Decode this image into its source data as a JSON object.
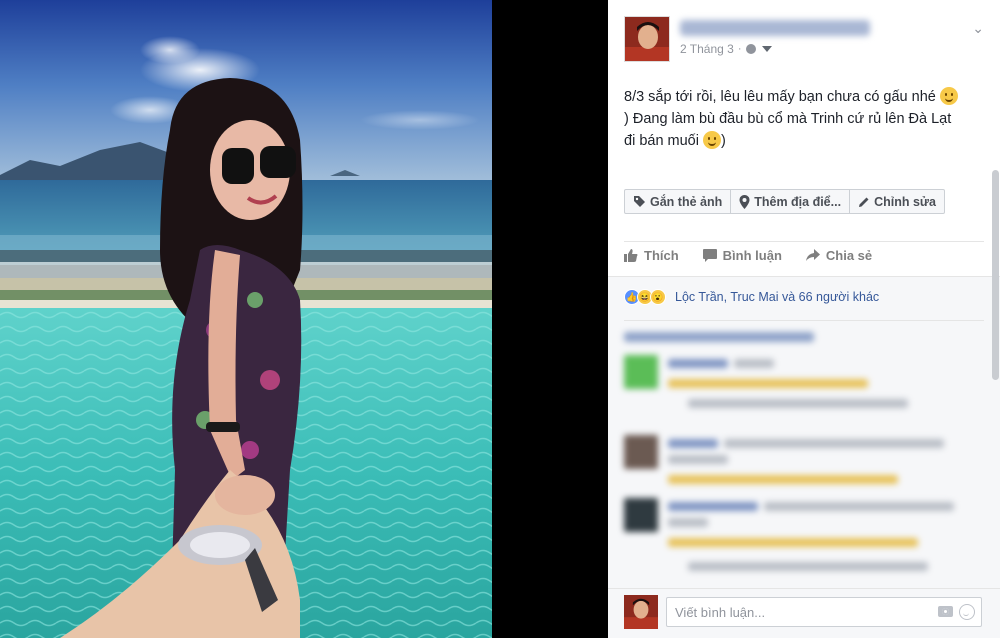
{
  "post": {
    "time": "2 Tháng 3",
    "separator": "·",
    "text_line1": "8/3 sắp tới rồi, lêu lêu mấy bạn chưa có gấu nhé ",
    "text_line2": ") Đang làm bù đầu bù cổ mà Trinh cứ rủ lên Đà Lạt",
    "text_line3": "đi bán muối ",
    "text_line3_end": ")"
  },
  "photo_actions": {
    "tag_label": "Gắn thẻ ảnh",
    "location_label": "Thêm địa điể...",
    "edit_label": "Chỉnh sửa"
  },
  "like_bar": {
    "like_label": "Thích",
    "comment_label": "Bình luận",
    "share_label": "Chia sẻ"
  },
  "reactions": {
    "text": "Lộc Trần, Truc Mai và 66 người khác"
  },
  "composer": {
    "placeholder": "Viết bình luận..."
  },
  "colors": {
    "link": "#365899",
    "panel_bg": "#ffffff",
    "gray_bg": "#f6f7f9",
    "like_blue": "#5890ff"
  },
  "icons": [
    "tag-icon",
    "location-pin-icon",
    "pencil-icon",
    "thumbs-up-icon",
    "comment-icon",
    "share-icon",
    "globe-icon",
    "camera-icon",
    "emoji-icon",
    "chevron-down-icon"
  ]
}
